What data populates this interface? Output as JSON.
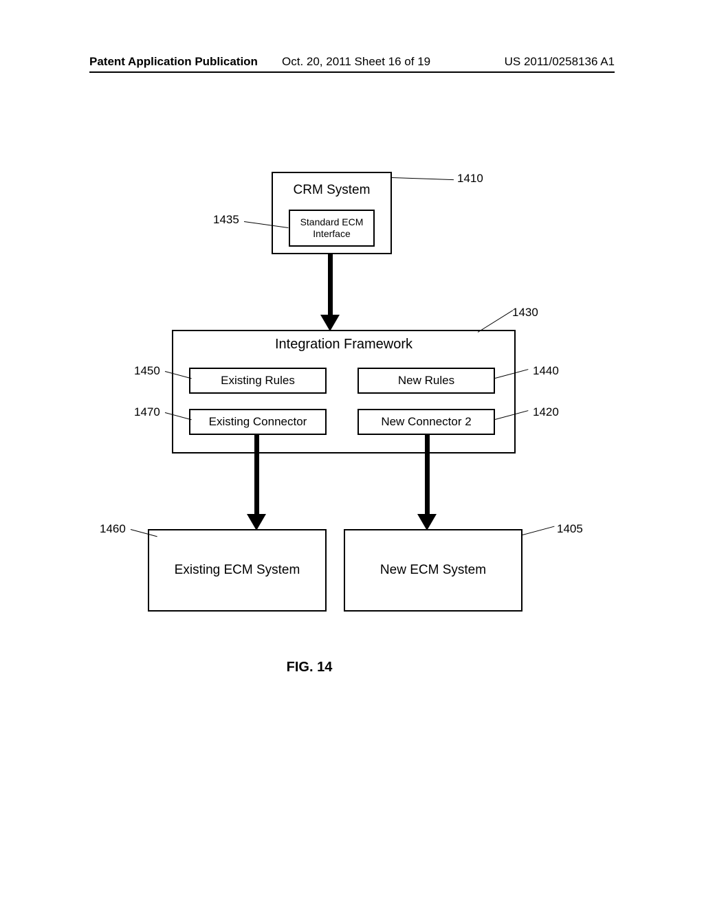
{
  "header": {
    "left": "Patent Application Publication",
    "center": "Oct. 20, 2011  Sheet 16 of 19",
    "right": "US 2011/0258136 A1"
  },
  "crm": {
    "title": "CRM System",
    "iface_line1": "Standard ECM",
    "iface_line2": "Interface"
  },
  "if": {
    "title": "Integration Framework",
    "er": "Existing Rules",
    "nr": "New Rules",
    "ec": "Existing Connector",
    "nc": "New Connector 2"
  },
  "ecm": {
    "existing": "Existing ECM System",
    "new": "New ECM System"
  },
  "refs": {
    "r1410": "1410",
    "r1435": "1435",
    "r1430": "1430",
    "r1450": "1450",
    "r1440": "1440",
    "r1470": "1470",
    "r1420": "1420",
    "r1460": "1460",
    "r1405": "1405"
  },
  "figure": "FIG. 14"
}
